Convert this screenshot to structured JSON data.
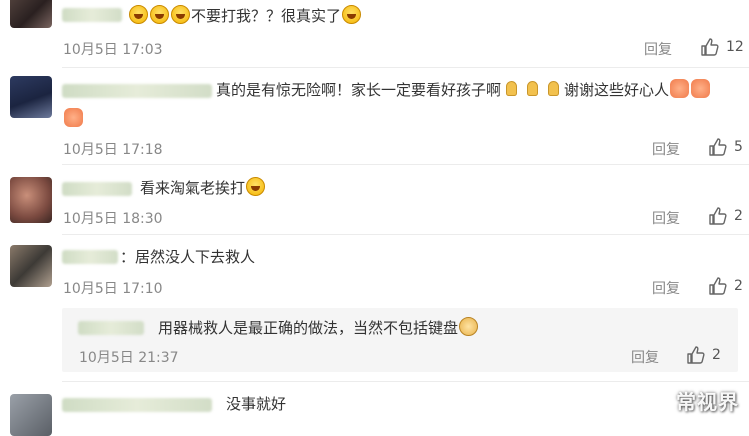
{
  "comments": [
    {
      "text": "不要打我？？很真实了",
      "date": "10月5日",
      "time": "17:03",
      "reply_label": "回复",
      "likes": "12"
    },
    {
      "text_line1": "真的是有惊无险啊！家长一定要看好孩子啊",
      "text_mid": "谢谢这些好心人",
      "date": "10月5日",
      "time": "17:18",
      "reply_label": "回复",
      "likes": "5"
    },
    {
      "text": "看来淘氣老挨打",
      "date": "10月5日",
      "time": "18:30",
      "reply_label": "回复",
      "likes": "2"
    },
    {
      "text": "：居然没人下去救人",
      "date": "10月5日",
      "time": "17:10",
      "reply_label": "回复",
      "likes": "2",
      "sub_reply": {
        "text": "用器械救人是最正确的做法，当然不包括键盘",
        "date": "10月5日",
        "time": "21:37",
        "reply_label": "回复",
        "likes": "2"
      }
    },
    {
      "text": "没事就好"
    }
  ],
  "watermark": "常视界",
  "colors": {
    "meta_gray": "#888888",
    "text": "#333333",
    "sub_bg": "#f5f5f5"
  },
  "icons": {
    "like": "thumbs-up-icon",
    "emoji_laugh": "laughing-tears-emoji",
    "emoji_pray": "praying-hands-emoji",
    "emoji_fist": "fist-emoji",
    "emoji_doge": "doge-emoji"
  }
}
